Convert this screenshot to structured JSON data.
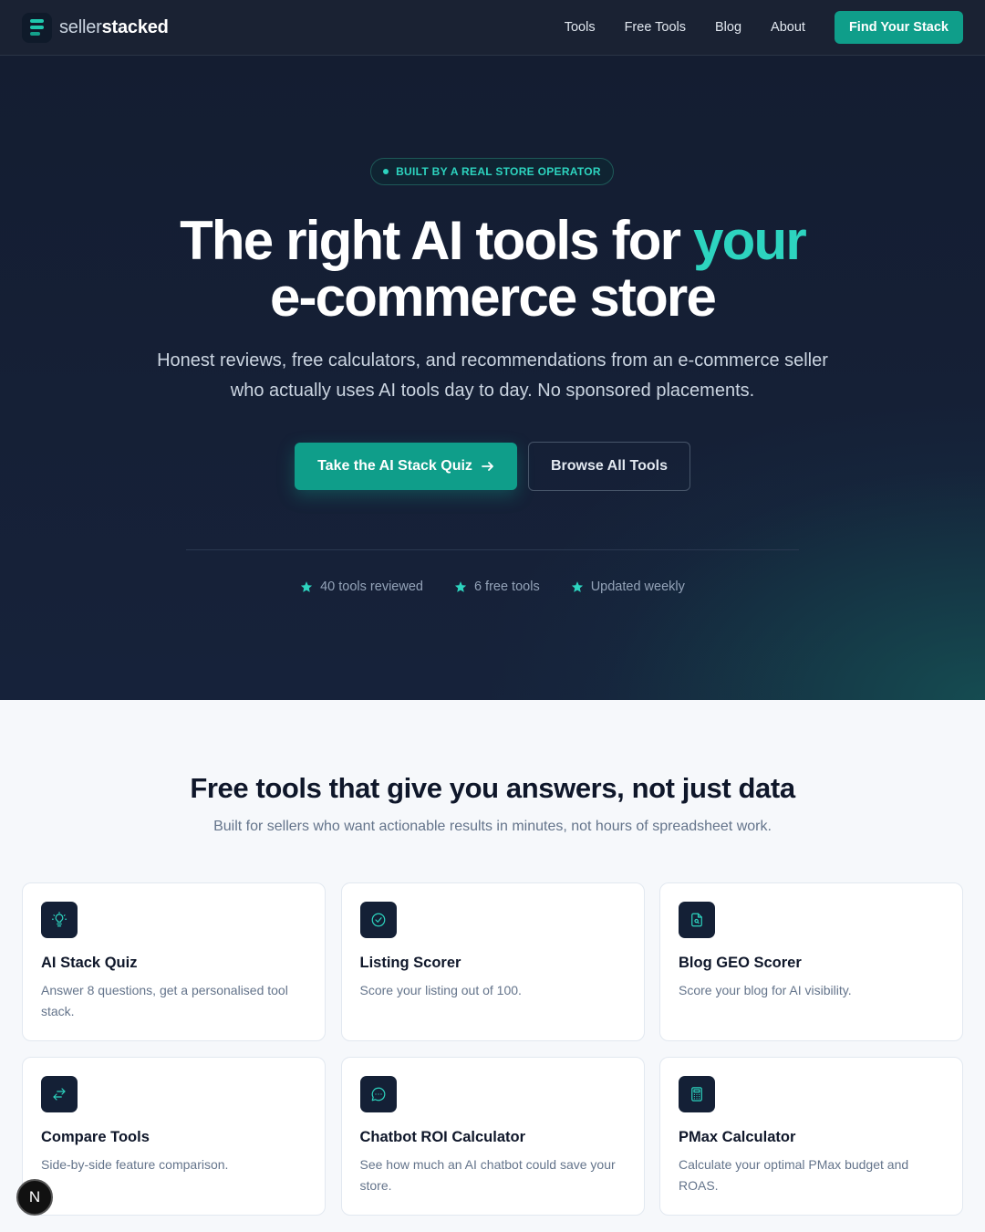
{
  "nav": {
    "logo_light": "seller",
    "logo_bold": "stacked",
    "links": [
      "Tools",
      "Free Tools",
      "Blog",
      "About"
    ],
    "cta": "Find Your Stack"
  },
  "hero": {
    "badge": "BUILT BY A REAL STORE OPERATOR",
    "title_line1": "The right AI tools for ",
    "title_accent": "your",
    "title_line2": "e-commerce store",
    "subtitle": "Honest reviews, free calculators, and recommendations from an e-commerce seller who actually uses AI tools day to day. No sponsored placements.",
    "primary_button": "Take the AI Stack Quiz",
    "secondary_button": "Browse All Tools",
    "stats": [
      "40 tools reviewed",
      "6 free tools",
      "Updated weekly"
    ]
  },
  "free_tools": {
    "title": "Free tools that give you answers, not just data",
    "subtitle": "Built for sellers who want actionable results in minutes, not hours of spreadsheet work.",
    "cards": [
      {
        "title": "AI Stack Quiz",
        "desc": "Answer 8 questions, get a personalised tool stack.",
        "icon": "lightbulb-icon"
      },
      {
        "title": "Listing Scorer",
        "desc": "Score your listing out of 100.",
        "icon": "check-circle-icon"
      },
      {
        "title": "Blog GEO Scorer",
        "desc": "Score your blog for AI visibility.",
        "icon": "document-search-icon"
      },
      {
        "title": "Compare Tools",
        "desc": "Side-by-side feature comparison.",
        "icon": "swap-arrows-icon"
      },
      {
        "title": "Chatbot ROI Calculator",
        "desc": "See how much an AI chatbot could save your store.",
        "icon": "chat-bubble-icon"
      },
      {
        "title": "PMax Calculator",
        "desc": "Calculate your optimal PMax budget and ROAS.",
        "icon": "calculator-icon"
      }
    ]
  },
  "overlay": {
    "next_badge": "N"
  },
  "colors": {
    "accent": "#2dd4bf",
    "brand_button": "#0f9e8a",
    "nav_bg": "#1a2233",
    "hero_bg": "#141d31"
  }
}
